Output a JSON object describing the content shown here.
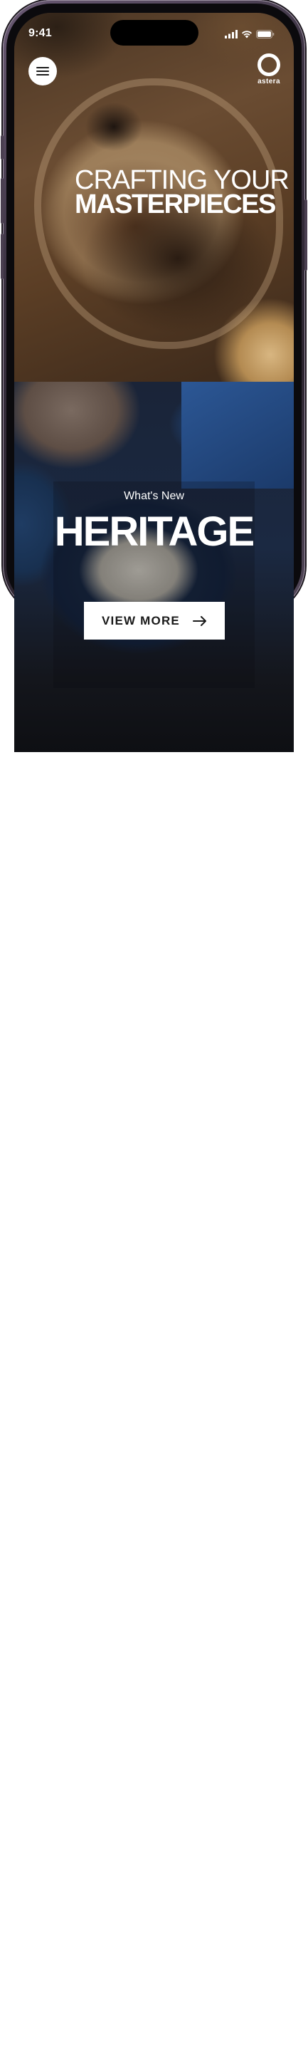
{
  "status_bar": {
    "time": "9:41"
  },
  "header": {
    "logo_text": "astera",
    "menu_icon": "hamburger-icon",
    "logo_icon": "ring-logo-icon"
  },
  "hero": {
    "title_line1": "CRAFTING YOUR",
    "title_line2": "MASTERPIECES"
  },
  "feature": {
    "subtitle": "What's New",
    "title": "HERITAGE",
    "cta_label": "VIEW MORE",
    "cta_icon": "arrow-right-icon"
  },
  "colors": {
    "text_light": "#ffffff",
    "button_bg": "#ffffff",
    "button_text": "#1a1a1a"
  }
}
